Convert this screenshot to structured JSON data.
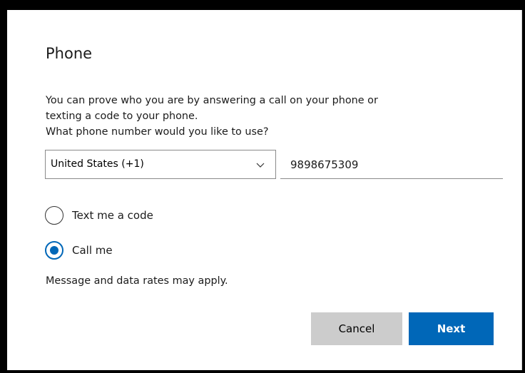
{
  "dialog": {
    "title": "Phone",
    "description_line1": "You can prove who you are by answering a call on your phone or",
    "description_line2": "texting a code to your phone.",
    "question": "What phone number would you like to use?"
  },
  "country_select": {
    "selected": "United States (+1)",
    "icon": "chevron-down-icon"
  },
  "phone_input": {
    "value": "9898675309"
  },
  "options": [
    {
      "label": "Text me a code",
      "selected": false
    },
    {
      "label": "Call me",
      "selected": true
    }
  ],
  "notice": "Message and data rates may apply.",
  "buttons": {
    "cancel": "Cancel",
    "next": "Next"
  },
  "colors": {
    "accent": "#0067b8",
    "cancel_bg": "#cccccc",
    "frame": "#000000"
  }
}
